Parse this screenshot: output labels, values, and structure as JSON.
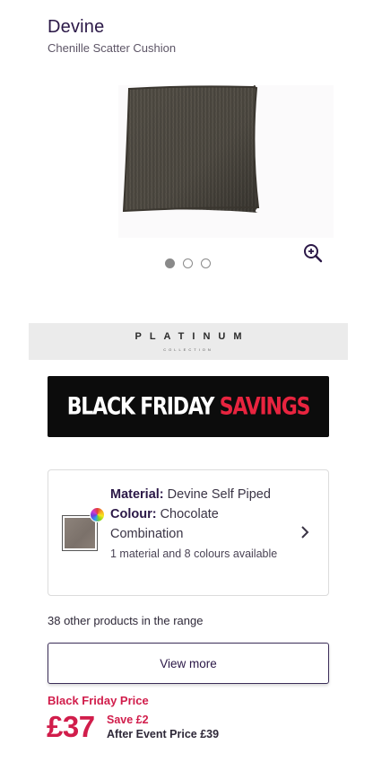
{
  "product": {
    "name": "Devine",
    "subtitle": "Chenille Scatter Cushion"
  },
  "gallery": {
    "image_subject": "cushion",
    "image_count": 3,
    "active_index": 0,
    "zoom_icon": "zoom-in-icon"
  },
  "collection": {
    "name": "PLATINUM",
    "tagline": "COLLECTION"
  },
  "banner": {
    "part1": "BLACK FRIDAY ",
    "part2": "SAVINGS",
    "color_white": "#ffffff",
    "color_red": "#e8243f"
  },
  "variant": {
    "material_label": "Material:",
    "material_value": "Devine Self Piped",
    "colour_label": "Colour:",
    "colour_value": "Chocolate Combination",
    "options_text": "1 material and 8 colours available",
    "swatch_color": "#857a72",
    "chevron_icon": "chevron-right-icon"
  },
  "range": {
    "text": "38 other products in the range",
    "view_more_label": "View more"
  },
  "pricing": {
    "label": "Black Friday Price",
    "price": "£37",
    "save_text": "Save £2",
    "after_event_text": "After Event Price £39",
    "accent_color": "#d11d4b"
  }
}
